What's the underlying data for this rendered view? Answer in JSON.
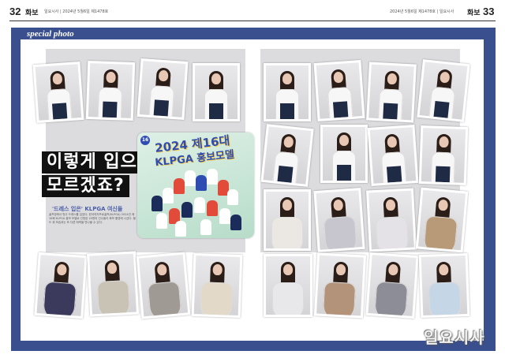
{
  "header": {
    "left_page": "32",
    "left_section": "화보",
    "left_meta": "일요시사 | 2024년 5월6일 제1478호",
    "right_meta": "2024년 5월6일 제1478호 | 일요시사",
    "right_section": "화보",
    "right_page": "33"
  },
  "section_tab": "special photo",
  "headline": {
    "line1": "이렇게 입으니",
    "line2": "모르겠죠?",
    "subhead": "'드레스 입은' KLPGA 여신들",
    "body_text": "골프장에서 벗고 드레스를 입었다. 한국여자프로골프(KLPGA) 2024년 제16회 KLPGA 홍보 모델로 선정된 20명의 선수들이 화보 촬영에 나섰다. 필드 위 모습과는 또 다른 매력을 만나볼 수 있다."
  },
  "poster": {
    "badge": "16",
    "title_line1": "2024 제16대",
    "title_line2": "KLPGA 홍보모델"
  },
  "watermark": "일요시사",
  "colors": {
    "frame_blue": "#3a4f8e",
    "panel_gray": "#dcdcde",
    "poster_green": "#c9e6d7",
    "poster_title_blue": "#2f4cb2"
  }
}
